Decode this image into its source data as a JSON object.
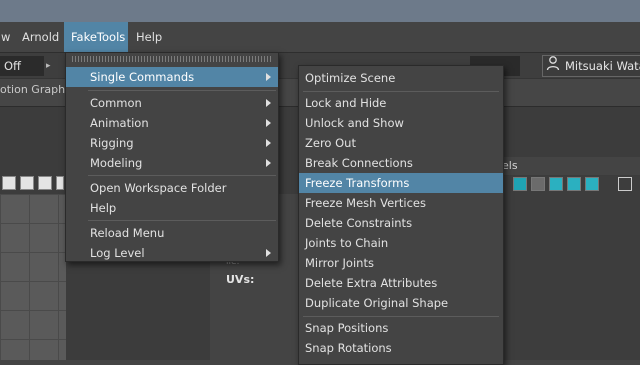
{
  "menubar": {
    "items": [
      {
        "label": "w"
      },
      {
        "label": "Arnold"
      },
      {
        "label": "FakeTools"
      },
      {
        "label": "Help"
      }
    ]
  },
  "statusline": {
    "off_value": "Off",
    "user_name": "Mitsuaki Wata"
  },
  "panels": {
    "motion_graph_label": "otion Graph",
    "uvs_label": "UVs:",
    "right_label": "els"
  },
  "menu_fake_tools": {
    "items": [
      {
        "label": "Single Commands"
      },
      {
        "label": "Common"
      },
      {
        "label": "Animation"
      },
      {
        "label": "Rigging"
      },
      {
        "label": "Modeling"
      },
      {
        "label": "Open Workspace Folder"
      },
      {
        "label": "Help"
      },
      {
        "label": "Reload Menu"
      },
      {
        "label": "Log Level"
      }
    ]
  },
  "menu_single_commands": {
    "items": [
      {
        "label": "Optimize Scene"
      },
      {
        "label": "Lock and Hide"
      },
      {
        "label": "Unlock and Show"
      },
      {
        "label": "Zero Out"
      },
      {
        "label": "Break Connections"
      },
      {
        "label": "Freeze Transforms"
      },
      {
        "label": "Freeze Mesh Vertices"
      },
      {
        "label": "Delete Constraints"
      },
      {
        "label": "Joints to Chain"
      },
      {
        "label": "Mirror Joints"
      },
      {
        "label": "Delete Extra Attributes"
      },
      {
        "label": "Duplicate Original Shape"
      },
      {
        "label": "Snap Positions"
      },
      {
        "label": "Snap Rotations"
      }
    ]
  },
  "colors": {
    "highlight": "#5285a6",
    "menu_bg": "#444444",
    "title_bar": "#6d7a8a"
  }
}
